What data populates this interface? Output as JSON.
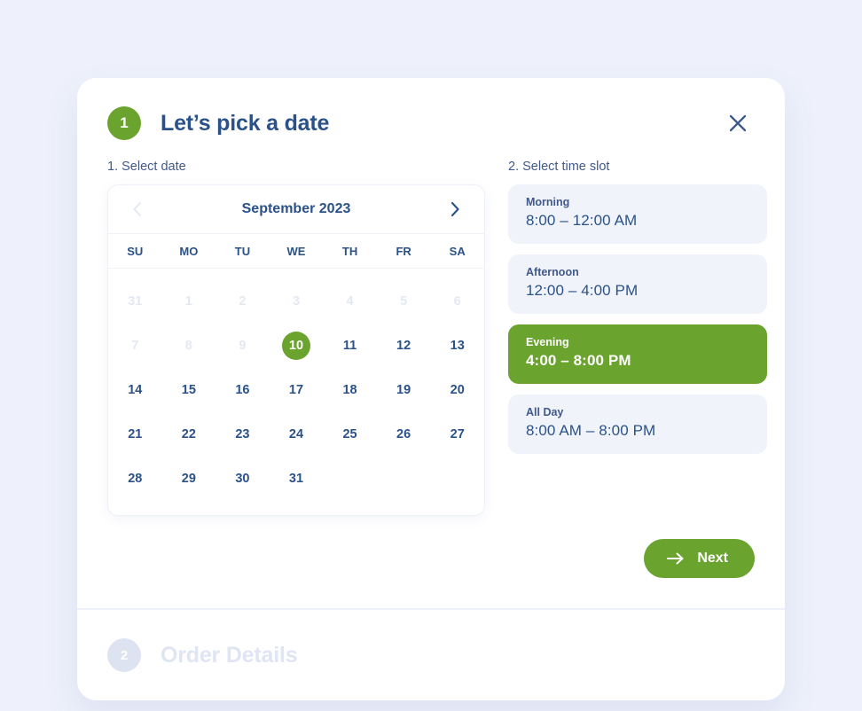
{
  "theme": {
    "page_background": "#eef1fb",
    "accent_green": "#6aa32e",
    "text_navy": "#2a5289",
    "slot_background": "#f0f3fa",
    "muted": "#e3e8f2"
  },
  "step_active": {
    "badge": "1",
    "title": "Let’s pick a date",
    "close_icon": "close-icon",
    "left_section_label": "1. Select date",
    "right_section_label": "2. Select time slot",
    "next_label": "Next",
    "next_icon": "arrow-right-icon"
  },
  "step_inactive": {
    "badge": "2",
    "title": "Order Details"
  },
  "calendar": {
    "month_label": "September 2023",
    "prev_icon": "chevron-left-icon",
    "next_icon": "chevron-right-icon",
    "weekdays": [
      "SU",
      "MO",
      "TU",
      "WE",
      "TH",
      "FR",
      "SA"
    ],
    "selected_day": "10",
    "weeks": [
      [
        {
          "label": "31",
          "state": "muted"
        },
        {
          "label": "1",
          "state": "muted"
        },
        {
          "label": "2",
          "state": "muted"
        },
        {
          "label": "3",
          "state": "muted"
        },
        {
          "label": "4",
          "state": "muted"
        },
        {
          "label": "5",
          "state": "muted"
        },
        {
          "label": "6",
          "state": "muted"
        }
      ],
      [
        {
          "label": "7",
          "state": "muted"
        },
        {
          "label": "8",
          "state": "muted"
        },
        {
          "label": "9",
          "state": "muted"
        },
        {
          "label": "10",
          "state": "selected"
        },
        {
          "label": "11",
          "state": "active"
        },
        {
          "label": "12",
          "state": "active"
        },
        {
          "label": "13",
          "state": "active"
        }
      ],
      [
        {
          "label": "14",
          "state": "active"
        },
        {
          "label": "15",
          "state": "active"
        },
        {
          "label": "16",
          "state": "active"
        },
        {
          "label": "17",
          "state": "active"
        },
        {
          "label": "18",
          "state": "active"
        },
        {
          "label": "19",
          "state": "active"
        },
        {
          "label": "20",
          "state": "active"
        }
      ],
      [
        {
          "label": "21",
          "state": "active"
        },
        {
          "label": "22",
          "state": "active"
        },
        {
          "label": "23",
          "state": "active"
        },
        {
          "label": "24",
          "state": "active"
        },
        {
          "label": "25",
          "state": "active"
        },
        {
          "label": "26",
          "state": "active"
        },
        {
          "label": "27",
          "state": "active"
        }
      ],
      [
        {
          "label": "28",
          "state": "active"
        },
        {
          "label": "29",
          "state": "active"
        },
        {
          "label": "30",
          "state": "active"
        },
        {
          "label": "31",
          "state": "active"
        },
        {
          "label": "",
          "state": "empty"
        },
        {
          "label": "",
          "state": "empty"
        },
        {
          "label": "",
          "state": "empty"
        }
      ]
    ]
  },
  "time_slots": [
    {
      "name": "Morning",
      "time": "8:00 – 12:00 AM",
      "selected": false
    },
    {
      "name": "Afternoon",
      "time": "12:00 – 4:00 PM",
      "selected": false
    },
    {
      "name": "Evening",
      "time": "4:00 – 8:00 PM",
      "selected": true
    },
    {
      "name": "All Day",
      "time": "8:00 AM – 8:00 PM",
      "selected": false
    }
  ]
}
